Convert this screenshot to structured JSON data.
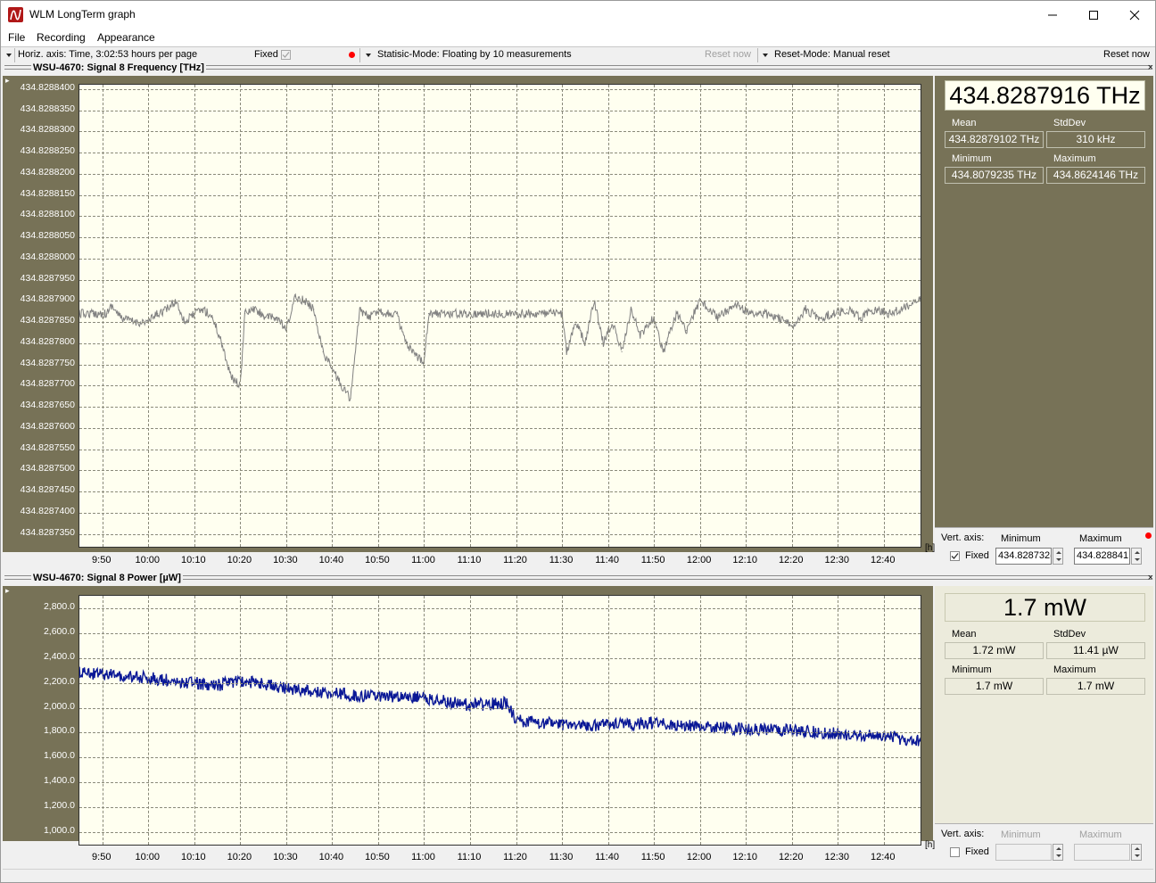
{
  "window": {
    "title": "WLM LongTerm graph",
    "controls": [
      "minimize",
      "maximize",
      "close"
    ]
  },
  "menu": {
    "items": [
      "File",
      "Recording",
      "Appearance"
    ]
  },
  "toolbar": {
    "horiz_axis": "Horiz. axis: Time,  3:02:53 hours per page",
    "fixed_label": "Fixed",
    "statistic_mode": "Statisic-Mode: Floating by 10 measurements",
    "reset_now_left": "Reset now",
    "reset_mode": "Reset-Mode: Manual reset",
    "reset_now_right": "Reset now"
  },
  "colors": {
    "plot_bg": "#fffff0",
    "panel_olive": "#777257",
    "frequency_trace": "#808080",
    "power_trace": "#0a1896",
    "recording_dot": "#ff0000"
  },
  "frequency_panel": {
    "title": "WSU-4670: Signal 8  Frequency  [THz]",
    "y_ticks": [
      "434.8288400",
      "434.8288350",
      "434.8288300",
      "434.8288250",
      "434.8288200",
      "434.8288150",
      "434.8288100",
      "434.8288050",
      "434.8288000",
      "434.8287950",
      "434.8287900",
      "434.8287850",
      "434.8287800",
      "434.8287750",
      "434.8287700",
      "434.8287650",
      "434.8287600",
      "434.8287550",
      "434.8287500",
      "434.8287450",
      "434.8287400",
      "434.8287350"
    ],
    "x_ticks": [
      "9:50",
      "10:00",
      "10:10",
      "10:20",
      "10:30",
      "10:40",
      "10:50",
      "11:00",
      "11:10",
      "11:20",
      "11:30",
      "11:40",
      "11:50",
      "12:00",
      "12:10",
      "12:20",
      "12:30",
      "12:40"
    ],
    "x_unit": "[h]",
    "current": "434.8287916 THz",
    "mean_label": "Mean",
    "mean": "434.82879102 THz",
    "stddev_label": "StdDev",
    "stddev": "310 kHz",
    "min_label": "Minimum",
    "min": "434.8079235 THz",
    "max_label": "Maximum",
    "max": "434.8624146 THz",
    "vert_axis": {
      "label": "Vert. axis:",
      "fixed_label": "Fixed",
      "fixed": true,
      "min_label": "Minimum",
      "min_value": "434.828732(",
      "max_label": "Maximum",
      "max_value": "434.828841"
    }
  },
  "power_panel": {
    "title": "WSU-4670: Signal 8 Power  [µW]",
    "y_ticks": [
      "2,800.0",
      "2,600.0",
      "2,400.0",
      "2,200.0",
      "2,000.0",
      "1,800.0",
      "1,600.0",
      "1,400.0",
      "1,200.0",
      "1,000.0"
    ],
    "x_ticks": [
      "9:50",
      "10:00",
      "10:10",
      "10:20",
      "10:30",
      "10:40",
      "10:50",
      "11:00",
      "11:10",
      "11:20",
      "11:30",
      "11:40",
      "11:50",
      "12:00",
      "12:10",
      "12:20",
      "12:30",
      "12:40"
    ],
    "x_unit": "[h]",
    "current": "1.7 mW",
    "mean_label": "Mean",
    "mean": "1.72 mW",
    "stddev_label": "StdDev",
    "stddev": "11.41 µW",
    "min_label": "Minimum",
    "min": "1.7 mW",
    "max_label": "Maximum",
    "max": "1.7 mW",
    "vert_axis": {
      "label": "Vert. axis:",
      "fixed_label": "Fixed",
      "fixed": false,
      "min_label": "Minimum",
      "max_label": "Maximum"
    }
  },
  "chart_data": [
    {
      "type": "line",
      "title": "WSU-4670: Signal 8  Frequency  [THz]",
      "xlabel": "[h]",
      "ylabel": "",
      "x_range": [
        "9:45",
        "12:48"
      ],
      "ylim": [
        434.828732,
        434.828841
      ],
      "grid": true,
      "series": [
        {
          "x": [
            "9:45",
            "9:48",
            "9:51",
            "9:52",
            "9:54",
            "9:57",
            "10:00",
            "10:02",
            "10:04",
            "10:06",
            "10:08",
            "10:10",
            "10:12",
            "10:14",
            "10:16",
            "10:18",
            "10:20",
            "10:21",
            "10:23",
            "10:26",
            "10:28",
            "10:30",
            "10:32",
            "10:34",
            "10:36",
            "10:38",
            "10:40",
            "10:42",
            "10:44",
            "10:46",
            "10:48",
            "10:50",
            "10:52",
            "10:54",
            "10:56",
            "10:58",
            "11:00",
            "11:01",
            "11:10",
            "11:16",
            "11:17",
            "11:19",
            "11:28",
            "11:30",
            "11:31",
            "11:33",
            "11:35",
            "11:37",
            "11:39",
            "11:41",
            "11:43",
            "11:45",
            "11:47",
            "11:50",
            "11:52",
            "11:55",
            "11:57",
            "12:00",
            "12:02",
            "12:04",
            "12:06",
            "12:08",
            "12:11",
            "12:14",
            "12:17",
            "12:20",
            "12:23",
            "12:26",
            "12:29",
            "12:32",
            "12:35",
            "12:38",
            "12:41",
            "12:44",
            "12:48"
          ],
          "y": [
            434.828787,
            434.828787,
            434.828787,
            434.828789,
            434.828786,
            434.828785,
            434.828785,
            434.828787,
            434.828788,
            434.82879,
            434.828785,
            434.828787,
            434.828788,
            434.828786,
            434.82878,
            434.828772,
            434.82877,
            434.828787,
            434.828788,
            434.828786,
            434.828786,
            434.828783,
            434.828791,
            434.82879,
            434.828788,
            434.828778,
            434.828774,
            434.82877,
            434.828767,
            434.828788,
            434.828786,
            434.828788,
            434.828787,
            434.828787,
            434.82878,
            434.828777,
            434.828776,
            434.828787,
            434.828787,
            434.828787,
            434.828787,
            434.828787,
            434.828787,
            434.828787,
            434.828778,
            434.828785,
            434.82878,
            434.82879,
            434.82878,
            434.828785,
            434.828778,
            434.828788,
            434.828782,
            434.828786,
            434.828778,
            434.828787,
            434.828783,
            434.82879,
            434.828788,
            434.828786,
            434.828788,
            434.828789,
            434.828787,
            434.828787,
            434.828786,
            434.828784,
            434.828788,
            434.828786,
            434.828787,
            434.828788,
            434.828786,
            434.828788,
            434.828787,
            434.828788,
            434.828791
          ]
        }
      ]
    },
    {
      "type": "line",
      "title": "WSU-4670: Signal 8 Power  [µW]",
      "xlabel": "[h]",
      "ylabel": "",
      "x_range": [
        "9:45",
        "12:48"
      ],
      "ylim": [
        900,
        2900
      ],
      "grid": true,
      "series": [
        {
          "x": [
            "9:45",
            "9:55",
            "10:05",
            "10:15",
            "10:20",
            "10:28",
            "10:35",
            "10:45",
            "10:55",
            "11:00",
            "11:05",
            "11:10",
            "11:18",
            "11:20",
            "11:25",
            "11:35",
            "11:45",
            "11:50",
            "12:00",
            "12:10",
            "12:20",
            "12:30",
            "12:40",
            "12:48"
          ],
          "y": [
            2280,
            2260,
            2220,
            2180,
            2220,
            2170,
            2130,
            2100,
            2090,
            2080,
            2050,
            2020,
            2040,
            1900,
            1880,
            1860,
            1870,
            1880,
            1850,
            1830,
            1820,
            1790,
            1770,
            1730
          ]
        }
      ]
    }
  ]
}
